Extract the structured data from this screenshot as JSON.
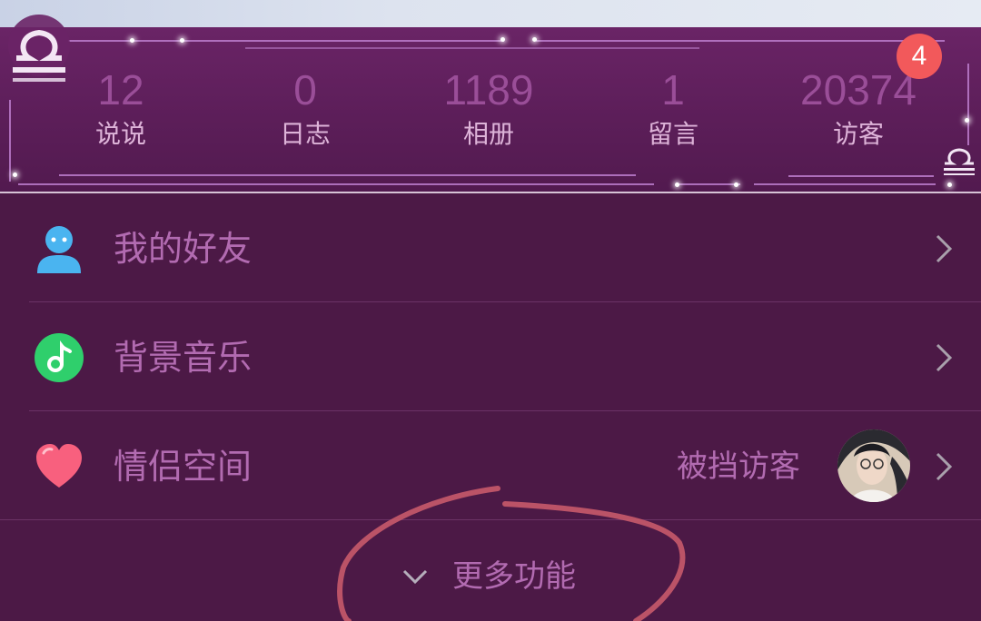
{
  "banner": {
    "badge_count": "4",
    "stats": [
      {
        "value": "12",
        "label": "说说"
      },
      {
        "value": "0",
        "label": "日志"
      },
      {
        "value": "1189",
        "label": "相册"
      },
      {
        "value": "1",
        "label": "留言"
      },
      {
        "value": "20374",
        "label": "访客"
      }
    ]
  },
  "menu": {
    "items": [
      {
        "label": "我的好友",
        "icon": "person-icon"
      },
      {
        "label": "背景音乐",
        "icon": "music-note-icon"
      },
      {
        "label": "情侣空间",
        "icon": "heart-icon",
        "extra": "被挡访客"
      }
    ],
    "more_label": "更多功能"
  },
  "colors": {
    "background": "#4c1946",
    "banner": "#5c1e59",
    "accent_text": "#b26bb1",
    "badge": "#f2595b",
    "annotation_circle": "#c85a6a"
  }
}
